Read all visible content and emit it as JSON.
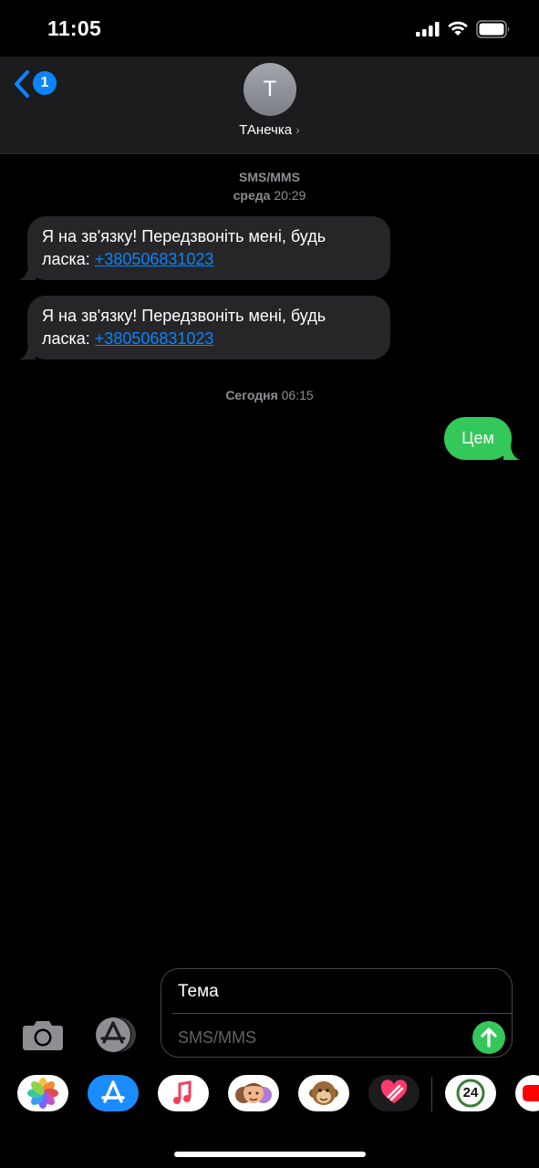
{
  "status_bar": {
    "time": "11:05"
  },
  "header": {
    "back_badge": "1",
    "avatar_initial": "Т",
    "contact_name": "ТАнечка"
  },
  "thread": {
    "service_label": "SMS/MMS",
    "first_day": "среда",
    "first_time": "20:29",
    "messages_in": [
      {
        "text": "Я на зв'язку! Передзвоніть мені, будь ласка: ",
        "link": "+380506831023"
      },
      {
        "text": "Я на зв'язку! Передзвоніть мені, будь ласка: ",
        "link": "+380506831023"
      }
    ],
    "second_day": "Сегодня",
    "second_time": "06:15",
    "message_out": "Цем"
  },
  "composer": {
    "subject_placeholder": "Тема",
    "message_placeholder": "SMS/MMS"
  },
  "app_drawer": {
    "apps": [
      "photos-app",
      "app-store-app",
      "music-app",
      "memoji-app",
      "animoji-app",
      "digital-touch-app",
      "24-app",
      "youtube-app"
    ],
    "badge_24": "24"
  },
  "colors": {
    "accent": "#0a84ff",
    "outgoing_bubble": "#34c759",
    "incoming_bubble": "#262628"
  }
}
